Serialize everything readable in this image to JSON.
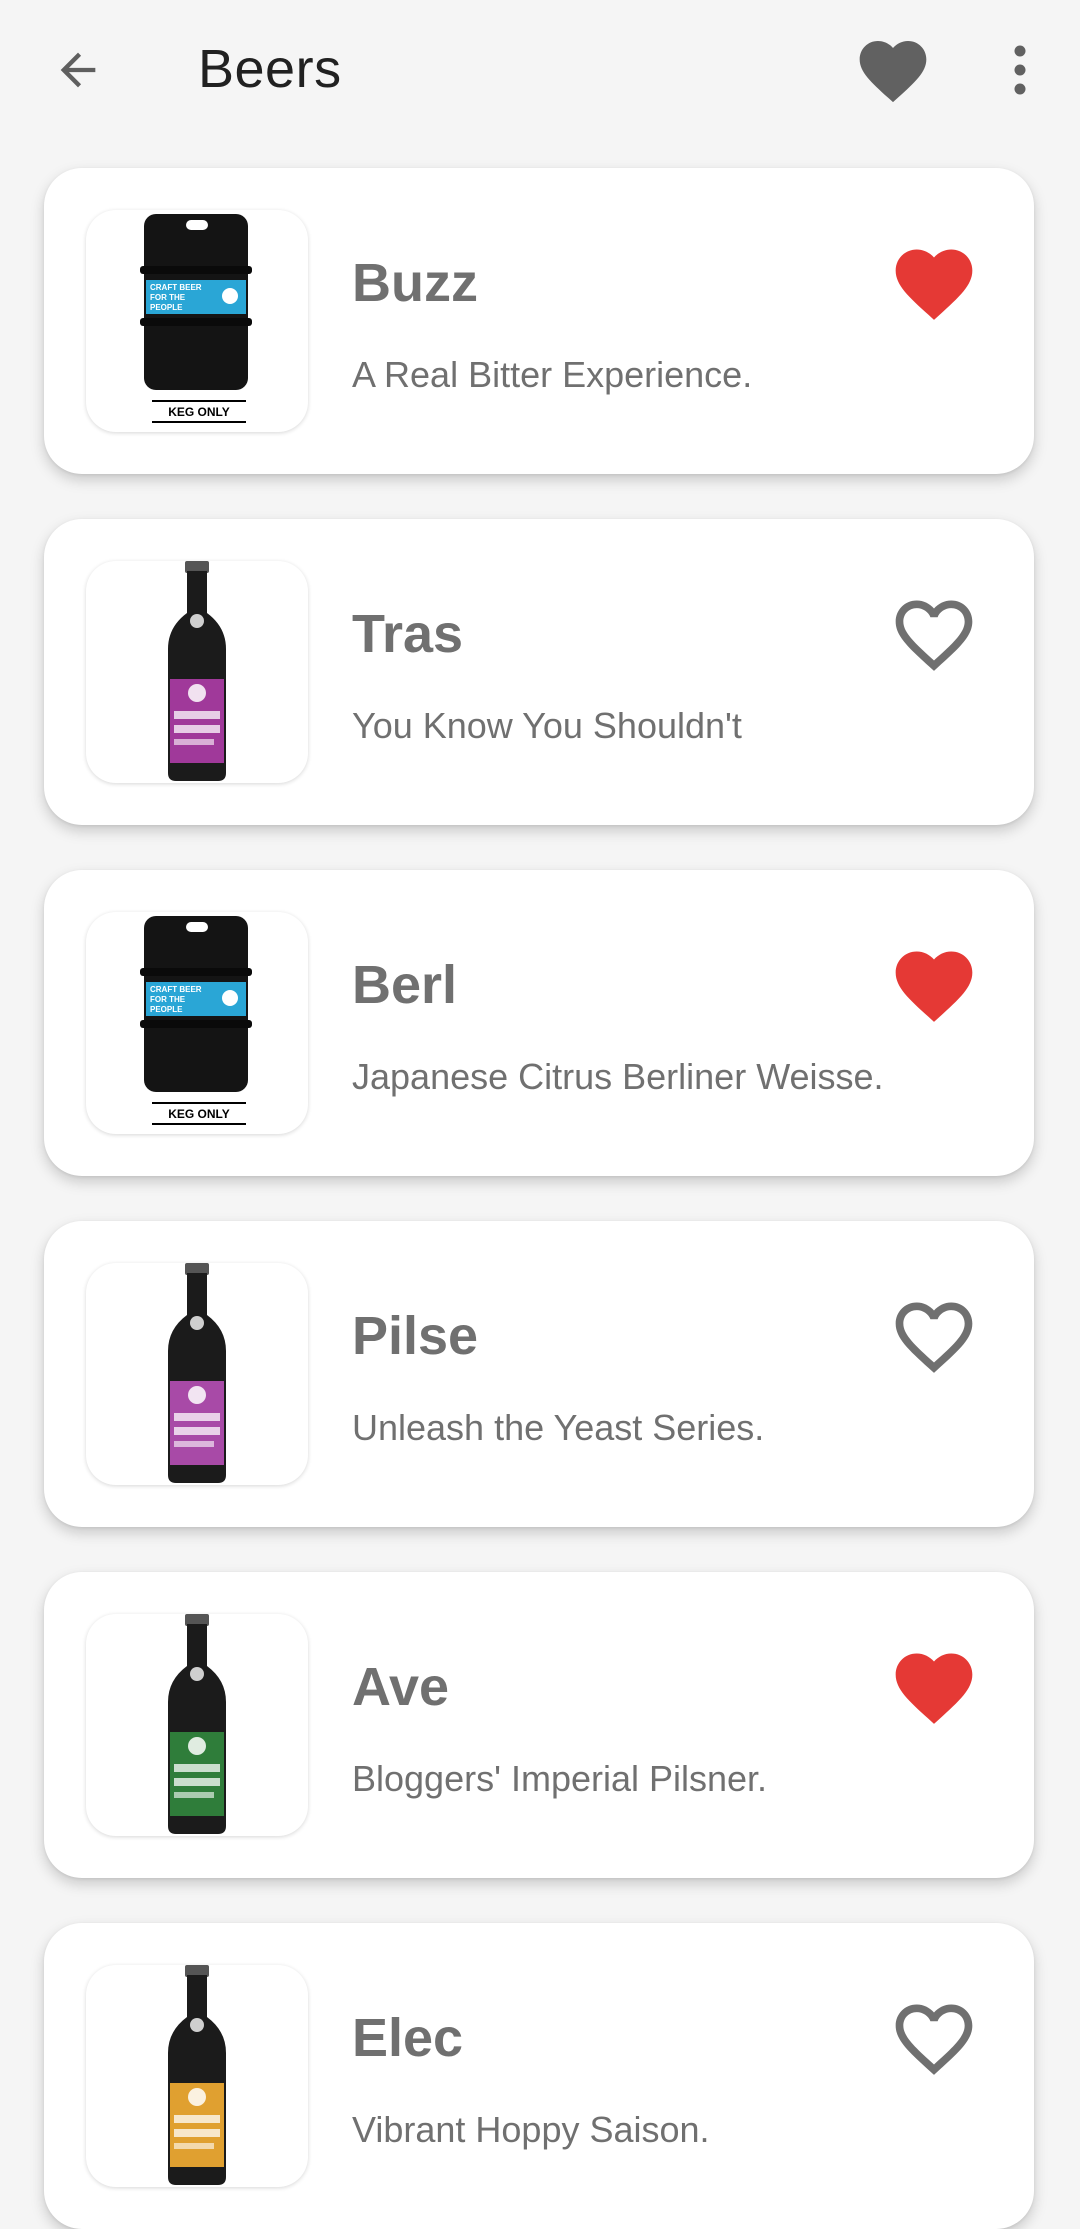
{
  "appbar": {
    "title": "Beers",
    "back_icon": "arrow-back-icon",
    "favorites_icon": "heart-filled-icon",
    "menu_icon": "more-vert-icon"
  },
  "colors": {
    "favorite": "#e53935",
    "outline": "#707070",
    "toolbar_heart": "#616161"
  },
  "beers": [
    {
      "name": "Buzz",
      "tagline": "A Real Bitter Experience.",
      "favorite": true,
      "image": "keg",
      "keg_label": "KEG ONLY"
    },
    {
      "name": "Tras",
      "tagline": "You Know You Shouldn't",
      "favorite": false,
      "image": "bottle",
      "label_color": "#a0399a"
    },
    {
      "name": "Berl",
      "tagline": "Japanese Citrus Berliner Weisse.",
      "favorite": true,
      "image": "keg",
      "keg_label": "KEG ONLY"
    },
    {
      "name": "Pilse",
      "tagline": "Unleash the Yeast Series.",
      "favorite": false,
      "image": "bottle",
      "label_color": "#a84aa7"
    },
    {
      "name": "Ave",
      "tagline": "Bloggers' Imperial Pilsner.",
      "favorite": true,
      "image": "bottle",
      "label_color": "#2f7d3a"
    },
    {
      "name": "Elec",
      "tagline": "Vibrant Hoppy Saison.",
      "favorite": false,
      "image": "bottle",
      "label_color": "#e0a030"
    }
  ]
}
